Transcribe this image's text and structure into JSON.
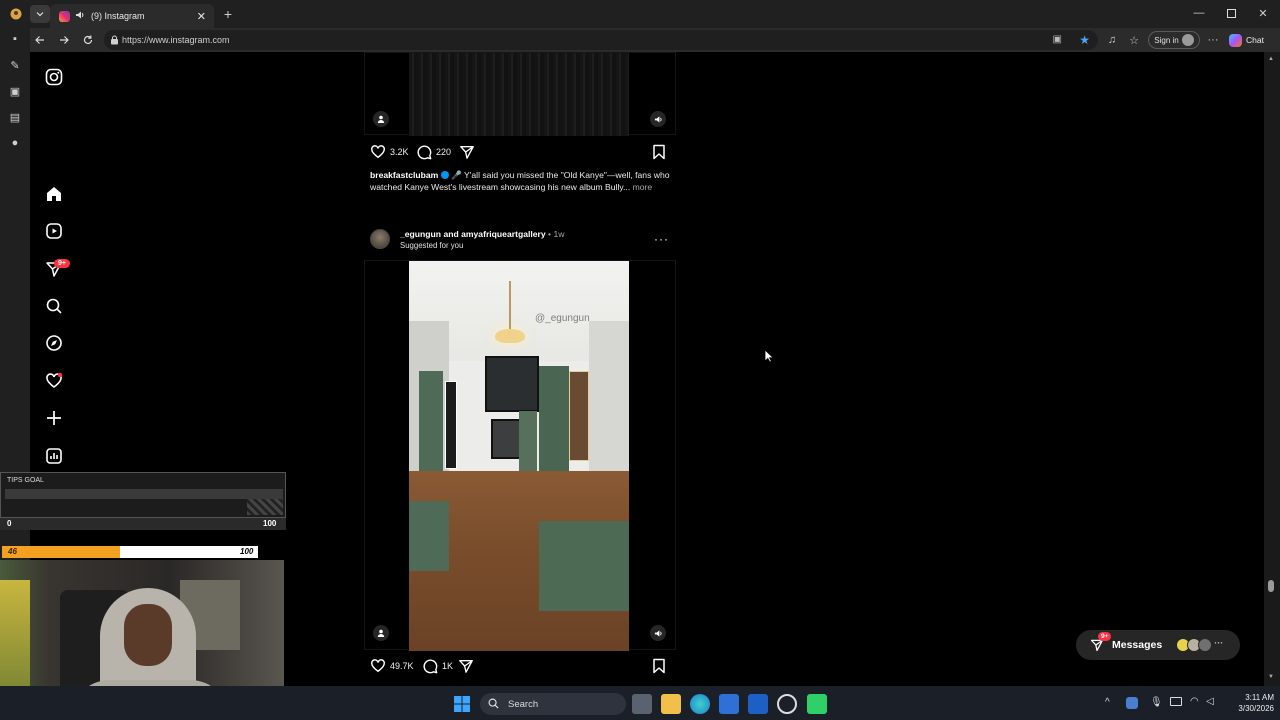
{
  "browser": {
    "tab_title": "(9) Instagram",
    "url": "https://www.instagram.com",
    "sign_in": "Sign in",
    "chat": "Chat"
  },
  "sidebar": {
    "notification_badge": "9+"
  },
  "posts": [
    {
      "likes": "3.2K",
      "comments": "220",
      "caption_user": "breakfastclubam",
      "caption_text": "🎤 Y'all said you missed the \"Old Kanye\"—well, fans who watched Kanye West's livestream showcasing his new album Bully...",
      "more": "more"
    },
    {
      "authors": "_egungun and amyafriqueartgallery",
      "time": "• 1w",
      "subtitle": "Suggested for you",
      "watermark": "@_egungun",
      "likes": "49.7K",
      "comments": "1K"
    }
  ],
  "overlay": {
    "tips_goal": "TIPS GOAL",
    "bar1_min": "0",
    "bar1_max": "100",
    "bar2_value": "46",
    "bar2_max": "100",
    "bar2_fraction": 0.46
  },
  "messages": {
    "label": "Messages",
    "badge": "9+"
  },
  "taskbar": {
    "search": "Search",
    "time": "3:11 AM",
    "date": "3/30/2026"
  },
  "colors": {
    "accent_red": "#ff3040",
    "progress_orange": "#f4a020",
    "link_blue": "#0095f6"
  }
}
